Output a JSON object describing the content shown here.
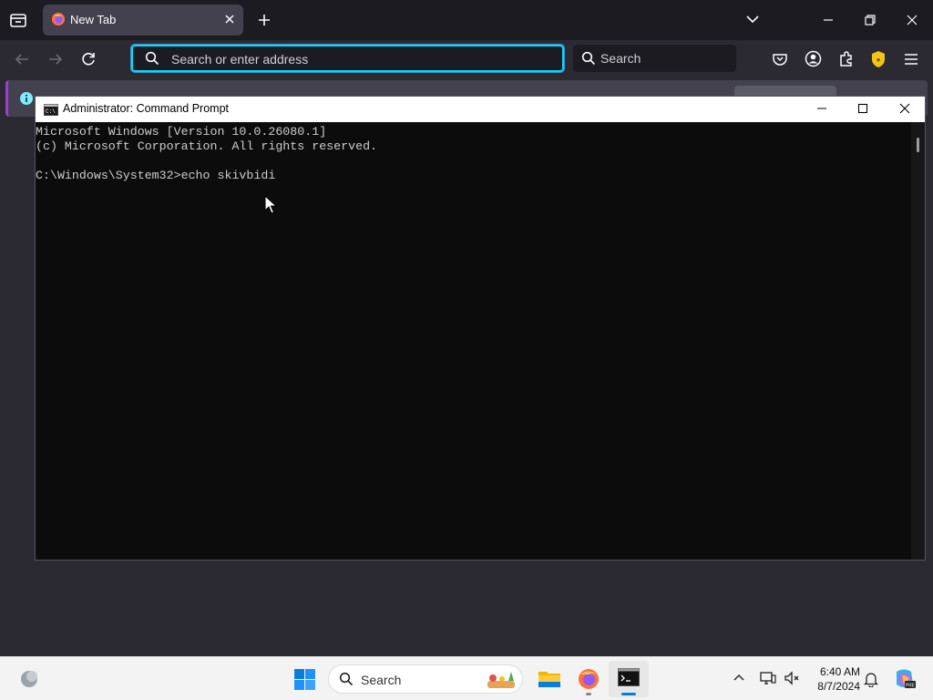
{
  "browser": {
    "tab": {
      "title": "New Tab",
      "favicon": "firefox-icon"
    },
    "urlbar": {
      "placeholder": "Search or enter address",
      "value": ""
    },
    "searchbar": {
      "placeholder": "Search"
    },
    "toolbar_icons": [
      "back-icon",
      "forward-icon",
      "reload-icon",
      "pocket-icon",
      "account-icon",
      "extensions-icon",
      "ublock-shield-icon",
      "menu-icon"
    ],
    "accent": "#00ddff"
  },
  "cmd": {
    "title": "Administrator: Command Prompt",
    "lines": [
      "Microsoft Windows [Version 10.0.26080.1]",
      "(c) Microsoft Corporation. All rights reserved.",
      "",
      "C:\\Windows\\System32>echo skivbidi"
    ]
  },
  "taskbar": {
    "search_label": "Search",
    "time": "6:40 AM",
    "date": "8/7/2024",
    "pinned": [
      "windows-start-icon",
      "file-explorer-icon",
      "firefox-icon",
      "command-prompt-icon"
    ]
  }
}
